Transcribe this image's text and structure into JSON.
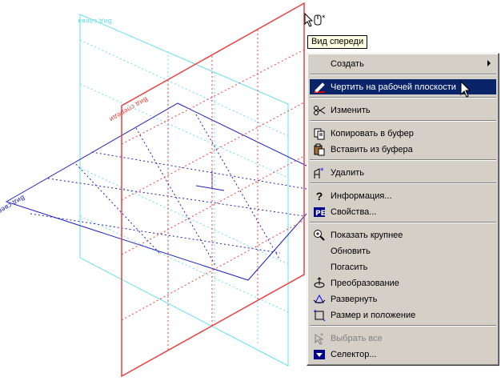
{
  "tooltip": "Вид спереди",
  "planes": {
    "back_label": "Вид слева",
    "front_label": "Вид спереди",
    "left_label": "Вид сверху"
  },
  "colors": {
    "cyan": "#66e0f0",
    "red": "#e84040",
    "blue": "#2020c0",
    "selection": "#0a246a"
  },
  "menu": {
    "items": [
      {
        "label": "Создать",
        "icon": "none",
        "submenu": true
      },
      {
        "label": "Чертить на рабочей плоскости",
        "icon": "pencil-icon",
        "selected": true
      },
      {
        "label": "Изменить",
        "icon": "scissors-icon"
      },
      {
        "label": "Копировать в буфер",
        "icon": "copy-icon"
      },
      {
        "label": "Вставить из буфера",
        "icon": "paste-icon"
      },
      {
        "label": "Удалить",
        "icon": "delete-icon"
      },
      {
        "label": "Информация...",
        "icon": "question-icon"
      },
      {
        "label": "Свойства...",
        "icon": "properties-icon"
      },
      {
        "label": "Показать крупнее",
        "icon": "zoom-icon"
      },
      {
        "label": "Обновить",
        "icon": "none"
      },
      {
        "label": "Погасить",
        "icon": "none"
      },
      {
        "label": "Преобразование",
        "icon": "transform-icon"
      },
      {
        "label": "Развернуть",
        "icon": "rotate-icon"
      },
      {
        "label": "Размер и положение",
        "icon": "resize-icon"
      },
      {
        "label": "Выбрать все",
        "icon": "select-all-icon",
        "disabled": true
      },
      {
        "label": "Селектор...",
        "icon": "selector-icon"
      }
    ]
  }
}
